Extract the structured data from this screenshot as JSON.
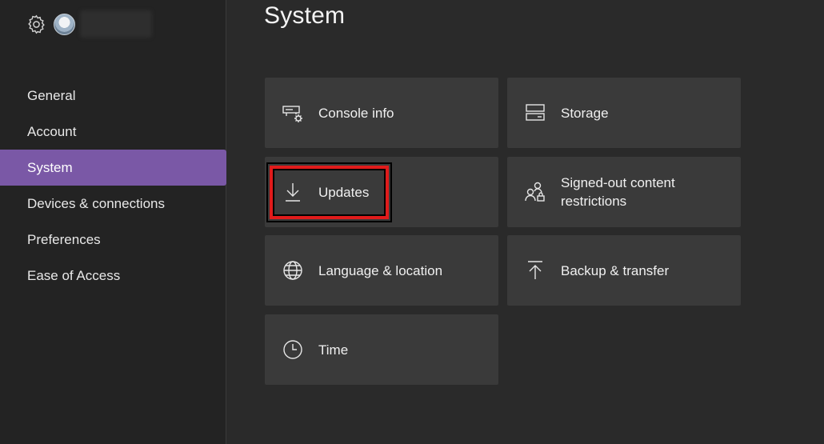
{
  "header": {
    "title": "System"
  },
  "user": {
    "gamertag": ""
  },
  "sidebar": {
    "items": [
      {
        "label": "General"
      },
      {
        "label": "Account"
      },
      {
        "label": "System",
        "active": true
      },
      {
        "label": "Devices & connections"
      },
      {
        "label": "Preferences"
      },
      {
        "label": "Ease of Access"
      }
    ]
  },
  "tiles": [
    {
      "label": "Console info",
      "icon": "console-info-icon"
    },
    {
      "label": "Storage",
      "icon": "storage-icon"
    },
    {
      "label": "Updates",
      "icon": "download-icon",
      "highlighted": true
    },
    {
      "label": "Signed-out content restrictions",
      "icon": "people-lock-icon"
    },
    {
      "label": "Language & location",
      "icon": "globe-icon"
    },
    {
      "label": "Backup & transfer",
      "icon": "upload-icon"
    },
    {
      "label": "Time",
      "icon": "clock-icon"
    }
  ],
  "colors": {
    "accent": "#7a58a6",
    "tile": "#3a3a3a",
    "background": "#2a2a2a",
    "sidebar": "#232323",
    "highlight": "#e01b1b"
  }
}
